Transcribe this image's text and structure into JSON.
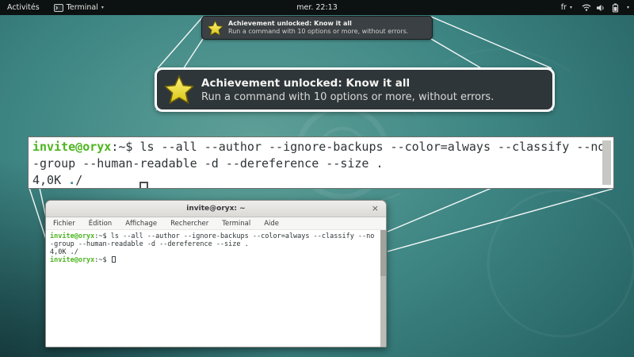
{
  "topbar": {
    "activities": "Activités",
    "app_name": "Terminal",
    "clock": "mer. 22:13",
    "keyboard": "fr",
    "caret": "▾"
  },
  "achievement": {
    "title": "Achievement unlocked: Know it all",
    "body": "Run a command with 10 options or more, without errors."
  },
  "terminal": {
    "title": "invite@oryx: ~",
    "close": "×",
    "menu": [
      "Fichier",
      "Édition",
      "Affichage",
      "Rechercher",
      "Terminal",
      "Aide"
    ],
    "prompt_user": "invite@oryx",
    "prompt_suffix": ":~$",
    "cmd_line1": " ls --all --author --ignore-backups --color=always --classify --no",
    "cmd_line2": "-group --human-readable -d --dereference --size .",
    "out_size": "4,0K ",
    "out_dir": ".",
    "out_classify": "/"
  },
  "colors": {
    "prompt_green": "#4db520",
    "directory_blue": "#2e7f93",
    "star_yellow": "#f2e33b",
    "notification_bg": "#3a4043",
    "callout_bg": "#2f3639",
    "topbar_bg": "#0c1111"
  }
}
